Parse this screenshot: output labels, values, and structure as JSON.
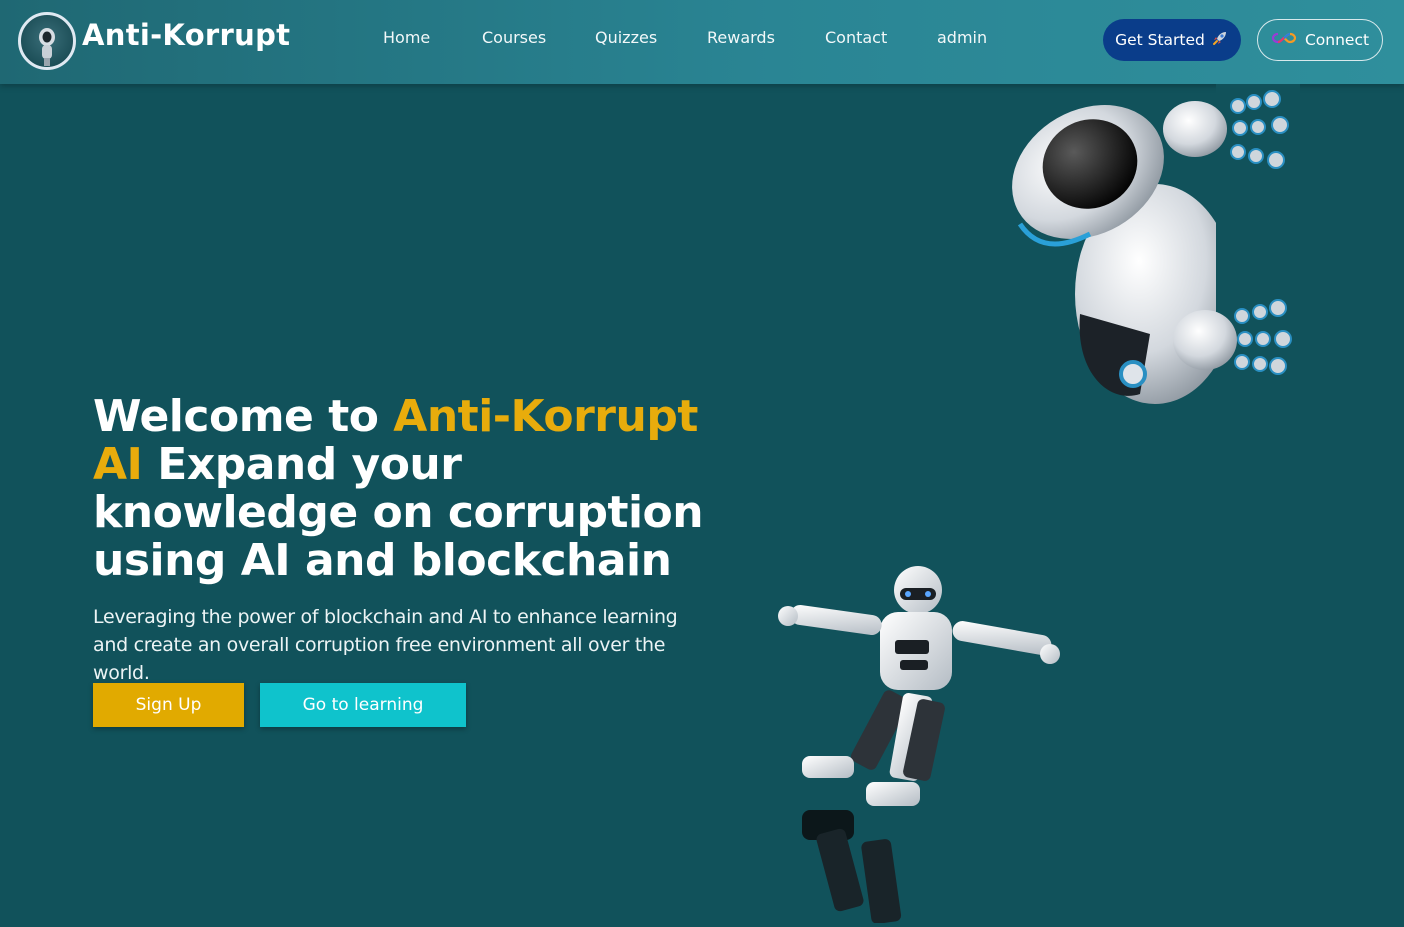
{
  "brand": {
    "name": "Anti-Korrupt"
  },
  "nav": {
    "links": [
      "Home",
      "Courses",
      "Quizzes",
      "Rewards",
      "Contact",
      "admin"
    ]
  },
  "actions": {
    "get_started": "Get Started",
    "connect": "Connect"
  },
  "hero": {
    "title_part1": "Welcome to ",
    "title_highlight": "Anti-Korrupt AI",
    "title_part2": " Expand your knowledge on corruption using AI and blockchain",
    "subtitle": "Leveraging the power of blockchain and AI to enhance learning and create an overall corruption free environment all over the world.",
    "signup_label": "Sign Up",
    "learning_label": "Go to learning"
  },
  "colors": {
    "background": "#11525b",
    "highlight": "#e8ac0c",
    "signup": "#e1aa00",
    "learning": "#0fc3cc",
    "get_started": "#0a3d8a"
  },
  "icons": {
    "logo": "robot-logo-icon",
    "rocket": "rocket-icon",
    "connect": "infinity-icon"
  }
}
